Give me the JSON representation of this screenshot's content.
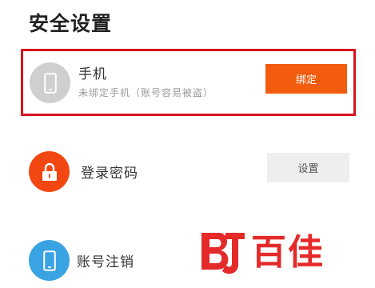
{
  "page": {
    "title": "安全设置"
  },
  "phone": {
    "label": "手机",
    "sublabel": "未绑定手机（账号容易被盗）",
    "button_label": "绑定",
    "icon": "phone-icon"
  },
  "password": {
    "label": "登录密码",
    "button_label": "设置",
    "icon": "lock-icon"
  },
  "cancel_account": {
    "label": "账号注销",
    "icon": "phone-icon"
  },
  "watermark": {
    "logo": "bj-logo",
    "text": "百佳"
  },
  "colors": {
    "accent": "#f35c0f",
    "highlight_border": "#d9141c",
    "lock_bg": "#f34712",
    "cancel_bg": "#3aa3e3",
    "phone_bg": "#cfcfcf",
    "watermark": "#e52a2a"
  }
}
